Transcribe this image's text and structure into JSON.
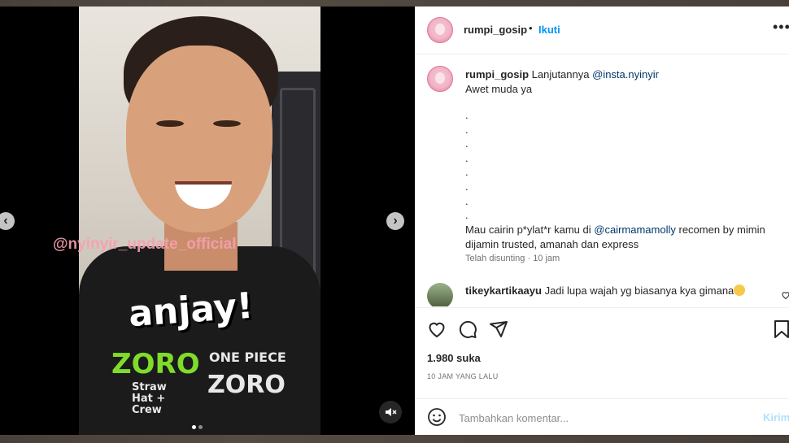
{
  "post": {
    "username": "rumpi_gosip",
    "separator": "•",
    "follow_label": "Ikuti",
    "more_label": "•••"
  },
  "media": {
    "watermark": "@nyinyir_update_official",
    "overlay_text": "anjay!",
    "shirt": {
      "zoro_a": "ZORO",
      "zoro_b": "ZORO",
      "onepiece": "ONE PIECE",
      "strawhat_line1": "Straw",
      "strawhat_line2": "Hat +",
      "strawhat_line3": "Crew"
    },
    "prev_label": "‹",
    "next_label": "›",
    "page_index": 1,
    "page_count": 2
  },
  "caption": {
    "username": "rumpi_gosip",
    "text_before_mention": "Lanjutannya",
    "mention": "@insta.nyinyir",
    "line2": "Awet muda ya",
    "dots": [
      ".",
      ".",
      ".",
      ".",
      ".",
      ".",
      ".",
      "."
    ],
    "line_promo_before": "Mau cairin p*ylat*r kamu di",
    "promo_mention": "@cairmamamolly",
    "line_promo_after": "recomen by mimin",
    "line_promo_2": "dijamin trusted, amanah dan express",
    "edited": "Telah disunting",
    "meta_sep": "·",
    "time": "10 jam"
  },
  "comment": {
    "username": "tikeykartikaayu",
    "text": "Jadi lupa wajah yg biasanya kya gimana"
  },
  "stats": {
    "likes": "1.980 suka",
    "posted": "10 JAM YANG LALU"
  },
  "add_comment": {
    "placeholder": "Tambahkan komentar...",
    "send_label": "Kirim"
  },
  "colors": {
    "accent": "#0095f6",
    "send_disabled": "#b2dffc",
    "watermark": "#f7a0b0",
    "shirt_green": "#7fdc2a"
  }
}
